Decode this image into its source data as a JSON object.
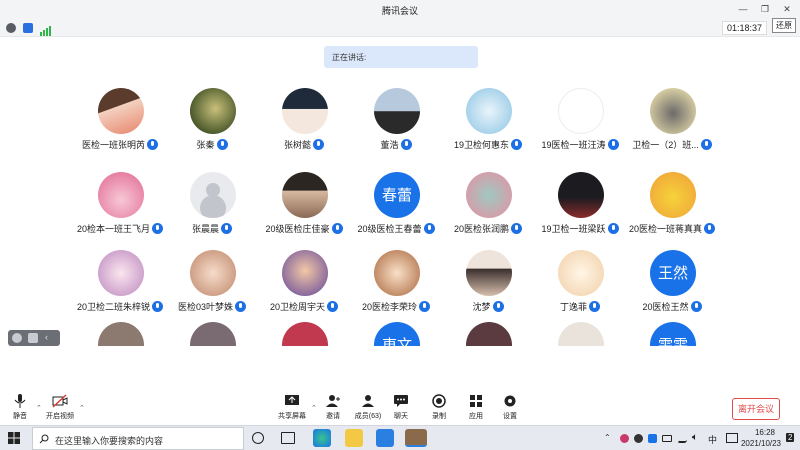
{
  "window": {
    "title": "腾讯会议"
  },
  "status": {
    "timer": "01:18:37",
    "restore_tip": "还原"
  },
  "speaking": {
    "label": "正在讲话:"
  },
  "participants": [
    [
      "医检一班张明芮",
      "张秦",
      "张树懿",
      "董浩",
      "19卫检何惠东",
      "19医检一班汪涛",
      "卫检一（2）班..."
    ],
    [
      "20检本一班王飞月",
      "张晨晨",
      "20级医检庄佳豪",
      "20级医检王春蕾",
      "20医检张润鹏",
      "19卫检一班梁跃",
      "20医检一班蒋真真"
    ],
    [
      "20卫检二班朱梓锐",
      "医检03叶梦姝",
      "20卫检周宇天",
      "20医检李荣玲",
      "沈梦",
      "丁逸菲",
      "20医检王然"
    ],
    [
      "",
      "",
      "",
      "",
      "",
      "",
      ""
    ]
  ],
  "avatar_texts": {
    "r1c3": "春蕾",
    "r2c6": "王然",
    "r3c3": "東文",
    "r3c6": "雯雯"
  },
  "toolbar": {
    "mute": "静音",
    "video": "开启视频",
    "share": "共享屏幕",
    "invite": "邀请",
    "members": "成员(63)",
    "chat": "聊天",
    "record": "录制",
    "apps": "应用",
    "settings": "设置",
    "leave": "离开会议"
  },
  "taskbar": {
    "search_placeholder": "在这里输入你要搜索的内容",
    "ime": "中",
    "time": "16:28",
    "date": "2021/10/23",
    "notifications": "2"
  },
  "colors": {
    "accent": "#1a72e8",
    "leave": "#e24a4a"
  }
}
